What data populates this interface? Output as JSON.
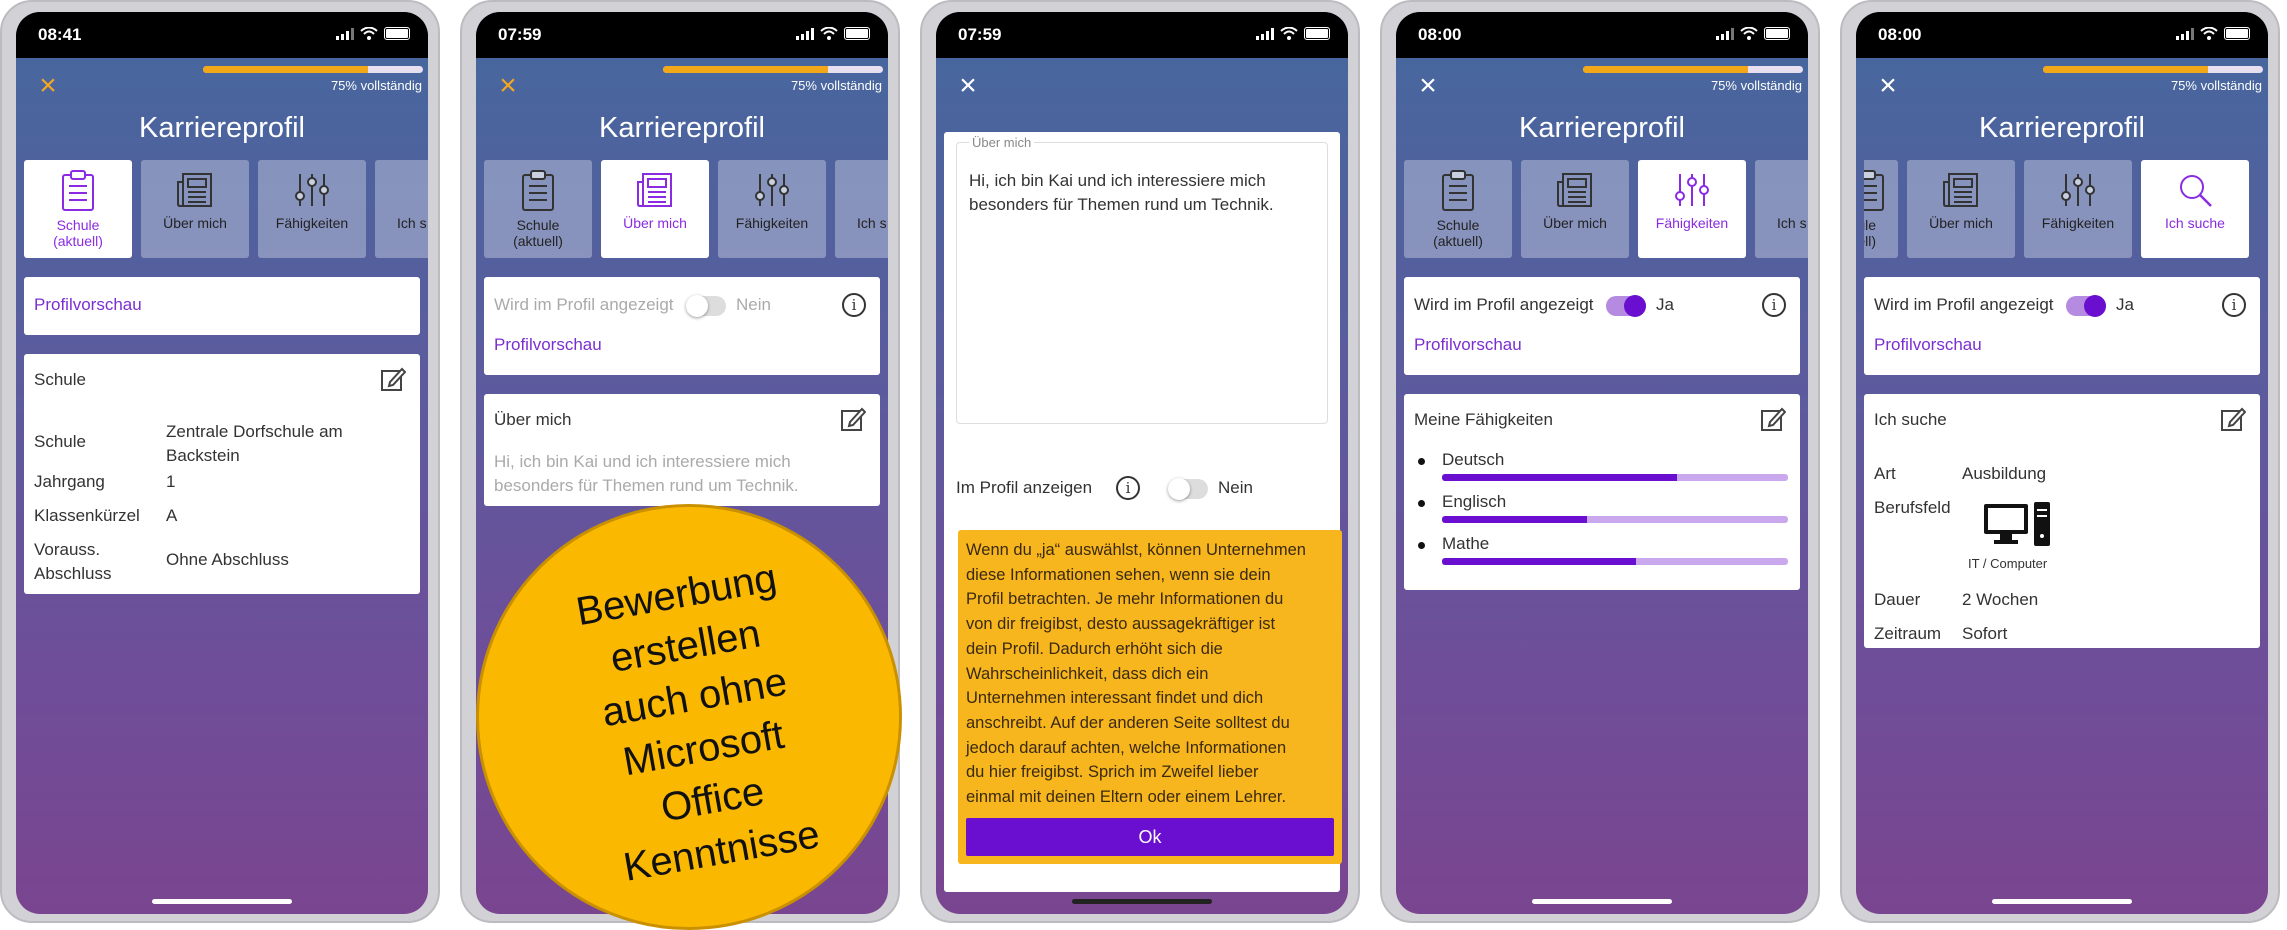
{
  "status": {
    "s1_time": "08:41",
    "s2_time": "07:59",
    "s3_time": "07:59",
    "s4_time": "08:00",
    "s5_time": "08:00"
  },
  "header": {
    "title": "Karriereprofil",
    "progress_text": "75% vollständig",
    "progress_value": 0.75,
    "close": "×"
  },
  "tabs": {
    "schule": "Schule (aktuell)",
    "schule_l1": "Schule",
    "schule_l2": "(aktuell)",
    "ueber": "Über mich",
    "faehig": "Fähigkeiten",
    "suche": "Ich suche",
    "suche_partial": "Ich s",
    "schule_partial_l1": "ule",
    "schule_partial_l2": "uell)"
  },
  "screen1": {
    "preview_link": "Profilvorschau",
    "card_title": "Schule",
    "rows": [
      {
        "label": "Schule",
        "value": "Zentrale Dorfschule am Backstein",
        "v1": "Zentrale Dorfschule am",
        "v2": "Backstein"
      },
      {
        "label": "Jahrgang",
        "value": "1"
      },
      {
        "label": "Klassenkürzel",
        "value": "A"
      },
      {
        "label": "Vorauss. Abschluss",
        "l1": "Vorauss.",
        "l2": "Abschluss",
        "value": "Ohne Abschluss"
      }
    ]
  },
  "screen2": {
    "shown_label": "Wird im Profil angezeigt",
    "toggle_value": "Nein",
    "preview_link": "Profilvorschau",
    "card_title": "Über mich",
    "text_l1": "Hi, ich bin Kai und ich interessiere mich",
    "text_l2": "besonders für Themen rund um Technik.",
    "badge_lines": [
      "Bewerbung",
      "erstellen",
      "auch ohne",
      "Microsoft",
      "Office",
      "Kenntnisse"
    ]
  },
  "screen3": {
    "field_label": "Über mich",
    "field_l1": "Hi, ich bin Kai und ich interessiere mich",
    "field_l2": "besonders für Themen rund um Technik.",
    "show_label": "Im Profil anzeigen",
    "toggle_value": "Nein",
    "info_lines": [
      "Wenn du „ja“ auswählst, können Unternehmen",
      "diese Informationen sehen, wenn sie dein",
      "Profil betrachten. Je mehr Informationen du",
      "von dir freigibst, desto aussagekräftiger ist",
      "dein Profil. Dadurch erhöht sich die",
      "Wahrscheinlichkeit, dass dich ein",
      "Unternehmen interessant findet und dich",
      "anschreibt. Auf der anderen Seite solltest du",
      "jedoch darauf achten, welche Informationen",
      "du hier freigibst. Sprich im Zweifel lieber",
      "einmal mit deinen Eltern oder einem Lehrer."
    ],
    "ok_label": "Ok"
  },
  "screen4": {
    "shown_label": "Wird im Profil angezeigt",
    "toggle_value": "Ja",
    "preview_link": "Profilvorschau",
    "card_title": "Meine Fähigkeiten",
    "skills": [
      {
        "name": "Deutsch",
        "level": 0.68
      },
      {
        "name": "Englisch",
        "level": 0.42
      },
      {
        "name": "Mathe",
        "level": 0.56
      }
    ]
  },
  "screen5": {
    "shown_label": "Wird im Profil angezeigt",
    "toggle_value": "Ja",
    "preview_link": "Profilvorschau",
    "card_title": "Ich suche",
    "art_label": "Art",
    "art_value": "Ausbildung",
    "beruf_label": "Berufsfeld",
    "beruf_caption": "IT / Computer",
    "dauer_label": "Dauer",
    "dauer_value": "2 Wochen",
    "zeit_label": "Zeitraum",
    "zeit_value": "Sofort"
  },
  "colors": {
    "accent": "#7b2fd1",
    "progress": "#f2a819",
    "warning": "#f7b51e",
    "badge": "#fbb800"
  },
  "icons": [
    "clipboard-icon",
    "newspaper-icon",
    "sliders-icon",
    "search-icon",
    "edit-icon",
    "info-icon",
    "close-icon",
    "computer-icon"
  ]
}
